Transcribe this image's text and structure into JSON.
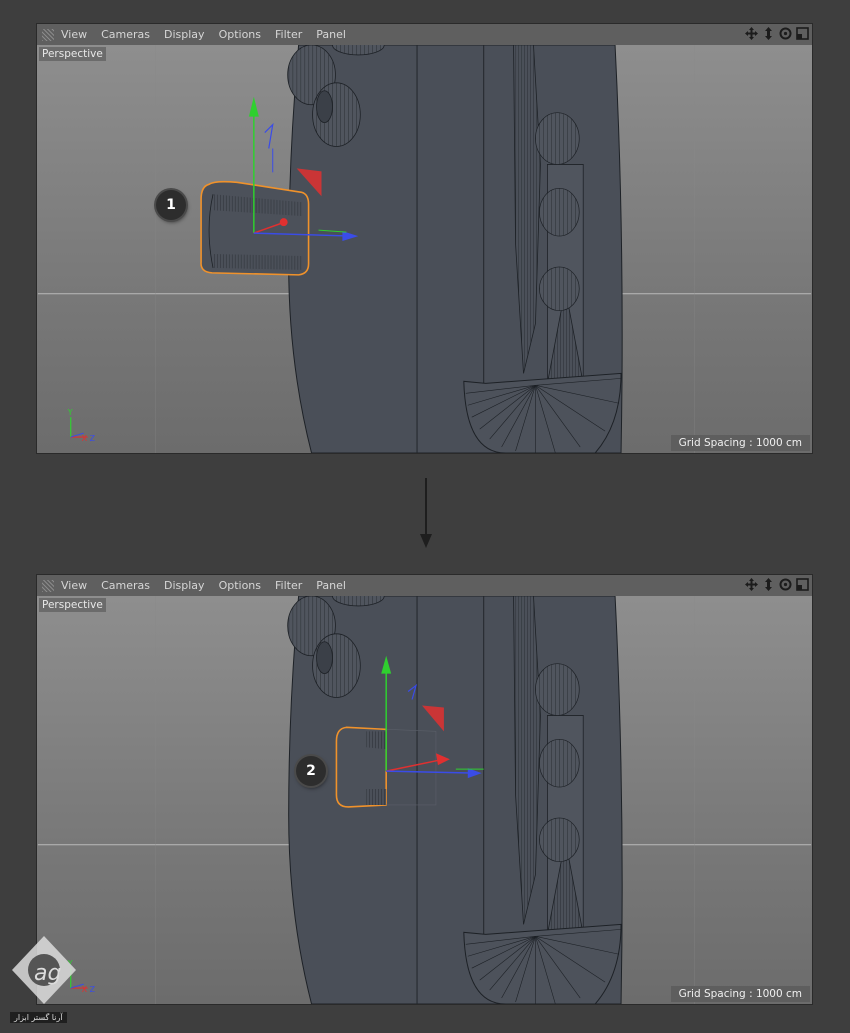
{
  "menu": {
    "items": [
      "View",
      "Cameras",
      "Display",
      "Options",
      "Filter",
      "Panel"
    ]
  },
  "icons": {
    "menu_grip": "grip-icon",
    "nav": [
      "move-view-icon",
      "zoom-view-icon",
      "rotate-view-icon",
      "toggle-view-icon"
    ]
  },
  "panels": [
    {
      "view_label": "Perspective",
      "grid_spacing": "Grid Spacing : 1000 cm",
      "step": "1"
    },
    {
      "view_label": "Perspective",
      "grid_spacing": "Grid Spacing : 1000 cm",
      "step": "2"
    }
  ],
  "axis_labels": {
    "x": "X",
    "y": "Y",
    "z": "Z"
  },
  "colors": {
    "selection": "#f0922b",
    "axis_x": "#e03030",
    "axis_y": "#2fd02f",
    "axis_z": "#3a4ce8",
    "mesh": "#4a4f58"
  },
  "watermark": {
    "text": "آرنا گستر ابزار"
  }
}
